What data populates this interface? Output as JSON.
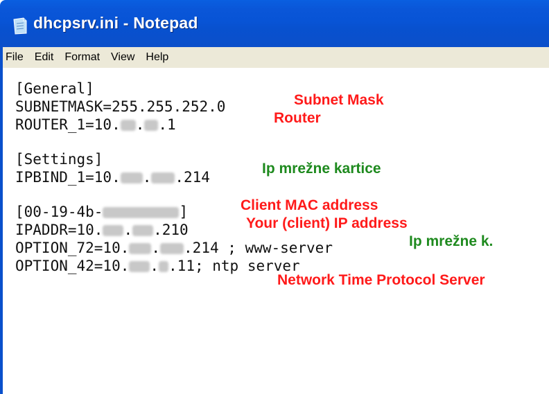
{
  "window": {
    "title": "dhcpsrv.ini - Notepad",
    "icon": "notepad-icon"
  },
  "menu": [
    "File",
    "Edit",
    "Format",
    "View",
    "Help"
  ],
  "lines": [
    {
      "pre": "[General]",
      "mid": "",
      "post": ""
    },
    {
      "pre": "SUBNETMASK=255.255.252.0",
      "mid": "",
      "post": ""
    },
    {
      "pre": "ROUTER_1=10.",
      "mid": ".",
      "post": ".1"
    },
    {
      "pre": "[Settings]",
      "mid": "",
      "post": ""
    },
    {
      "pre": "IPBIND_1=10.",
      "mid": ".",
      "post": ".214"
    },
    {
      "pre": "[00-19-4b-",
      "mid": "",
      "post": "]"
    },
    {
      "pre": "IPADDR=10.",
      "mid": ".",
      "post": ".210"
    },
    {
      "pre": "OPTION_72=10.",
      "mid": ".",
      "post": ".214 ; www-server"
    },
    {
      "pre": "OPTION_42=10.",
      "mid": ".",
      "post": ".11; ntp server"
    }
  ],
  "annotations": {
    "subnet": "Subnet Mask",
    "router": "Router",
    "ip_card": "Ip mrežne kartice",
    "client_mac": "Client MAC address",
    "client_ip": "Your (client) IP address",
    "ip_card_short": "Ip mrežne k.",
    "ntp": "Network Time Protocol Server"
  },
  "colors": {
    "titlebar": "#0a56d8",
    "annotation_red": "#ff1a1a",
    "annotation_green": "#1e8a1e"
  }
}
